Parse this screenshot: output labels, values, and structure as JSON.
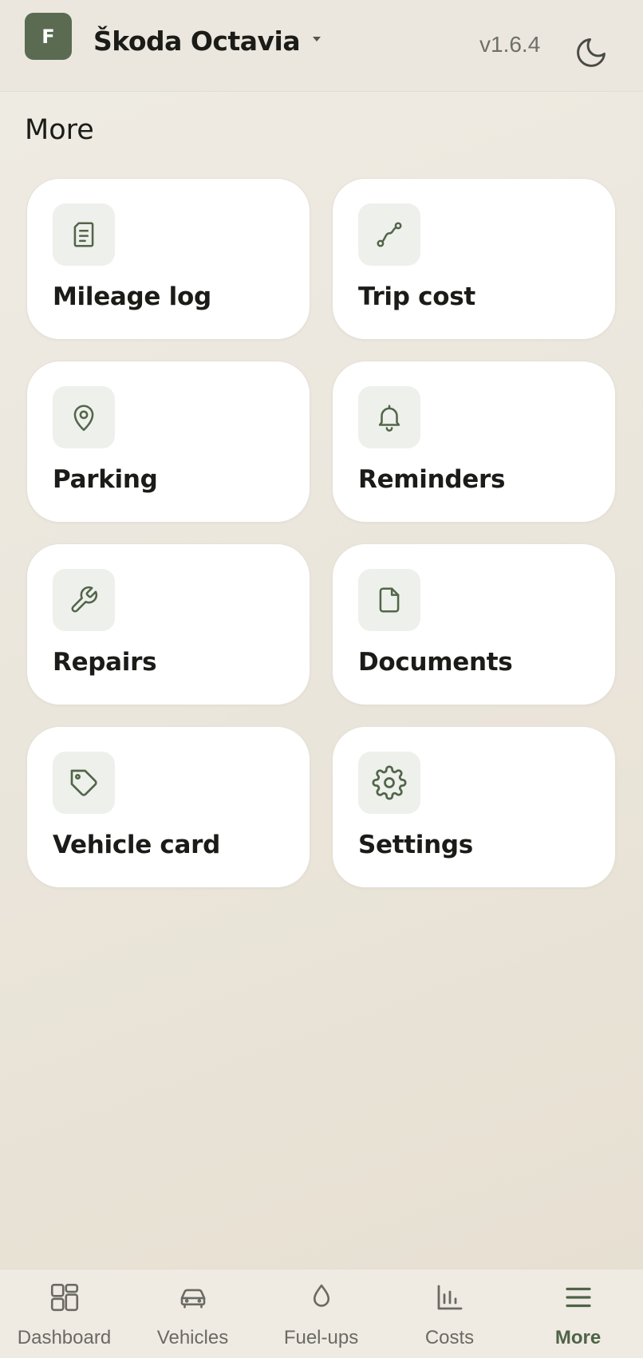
{
  "header": {
    "avatar_initial": "F",
    "vehicle_name": "Škoda Octavia",
    "version": "v1.6.4",
    "theme_icon": "moon-icon"
  },
  "page": {
    "title": "More"
  },
  "menu": [
    {
      "label": "Mileage log",
      "icon": "document-list-icon"
    },
    {
      "label": "Trip cost",
      "icon": "route-icon"
    },
    {
      "label": "Parking",
      "icon": "map-pin-icon"
    },
    {
      "label": "Reminders",
      "icon": "bell-icon"
    },
    {
      "label": "Repairs",
      "icon": "wrench-icon"
    },
    {
      "label": "Documents",
      "icon": "file-icon"
    },
    {
      "label": "Vehicle card",
      "icon": "tag-icon"
    },
    {
      "label": "Settings",
      "icon": "gear-icon"
    }
  ],
  "nav": {
    "active": "More",
    "items": [
      {
        "label": "Dashboard",
        "icon": "dashboard-icon"
      },
      {
        "label": "Vehicles",
        "icon": "car-icon"
      },
      {
        "label": "Fuel-ups",
        "icon": "droplet-icon"
      },
      {
        "label": "Costs",
        "icon": "bar-chart-icon"
      },
      {
        "label": "More",
        "icon": "menu-icon"
      }
    ]
  },
  "colors": {
    "accent": "#5a6b52",
    "icon_green": "#52654a",
    "background": "#ebe7de",
    "card": "#ffffff"
  }
}
